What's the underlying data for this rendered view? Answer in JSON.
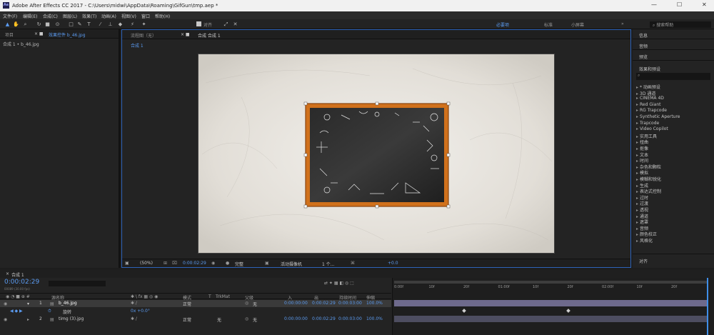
{
  "titlebar": {
    "title": "Adobe After Effects CC 2017 - C:\\Users\\midwi\\AppData\\Roaming\\GifGun\\tmp.aep *",
    "min": "—",
    "max": "☐",
    "close": "✕",
    "logo": "Ae"
  },
  "menu": [
    "文件(F)",
    "编辑(E)",
    "合成(C)",
    "图层(L)",
    "效果(T)",
    "动画(A)",
    "视图(V)",
    "窗口",
    "帮助(H)"
  ],
  "toolbar": {
    "snap_label": "对齐",
    "workspaces": [
      "必要项",
      "标准",
      "小屏幕"
    ],
    "active_workspace": "必要项",
    "search_placeholder": "搜索帮助"
  },
  "left_panel": {
    "tabs": [
      "项目",
      "效果控件 b_46.jpg"
    ],
    "subtitle": "合成 1 • b_46.jpg"
  },
  "comp_panel": {
    "tabs": [
      "流程图（无）",
      "合成 合成 1"
    ],
    "breadcrumb": "合成 1",
    "footer": {
      "zoom": "(50%)",
      "timecode": "0:00:02:29",
      "resolution": "完整",
      "camera": "活动摄像机",
      "views": "1 个...",
      "exposure": "+0.0"
    }
  },
  "right_panel": {
    "sections": [
      "信息",
      "音频",
      "预览"
    ],
    "effects_title": "效果和预设",
    "effects": [
      "* 动画预设",
      "3D 通道",
      "CINEMA 4D",
      "Red Giant",
      "RG Trapcode",
      "Synthetic Aperture",
      "Trapcode",
      "Video Copilot",
      "实用工具",
      "扭曲",
      "抠像",
      "文本",
      "时间",
      "杂色和颗粒",
      "模拟",
      "模糊和锐化",
      "生成",
      "表达式控制",
      "过时",
      "过渡",
      "透视",
      "通道",
      "遮罩",
      "音频",
      "颜色校正",
      "风格化"
    ],
    "bottom_section": "对齐"
  },
  "timeline": {
    "tab": "合成 1",
    "timecode": "0:00:02:29",
    "fps_info": "00089 (30.00 fps)",
    "columns": {
      "source": "源名称",
      "mode": "模式",
      "t": "T",
      "trkmat": "TrkMat",
      "parent": "父级",
      "in": "入",
      "out": "出",
      "duration": "持续时间",
      "stretch": "伸缩"
    },
    "layers": [
      {
        "num": "1",
        "name": "b_46.jpg",
        "mode": "正常",
        "trkmat": "",
        "parent": "无",
        "in": "0:00:00:00",
        "out": "0:00:02:29",
        "duration": "0:00:03:00",
        "stretch": "100.0%"
      },
      {
        "num": "",
        "name": "旋转",
        "mode": "",
        "trkmat": "",
        "parent": "",
        "in": "",
        "out": "",
        "duration": "",
        "stretch": "",
        "value": "0x +0.0°"
      },
      {
        "num": "2",
        "name": "timg (3).jpg",
        "mode": "正常",
        "trkmat": "无",
        "parent": "无",
        "in": "0:00:00:00",
        "out": "0:00:02:29",
        "duration": "0:00:03:00",
        "stretch": "100.0%"
      }
    ],
    "ruler": [
      "0:00f",
      "10f",
      "20f",
      "01:00f",
      "10f",
      "20f",
      "02:00f",
      "10f",
      "20f"
    ]
  }
}
